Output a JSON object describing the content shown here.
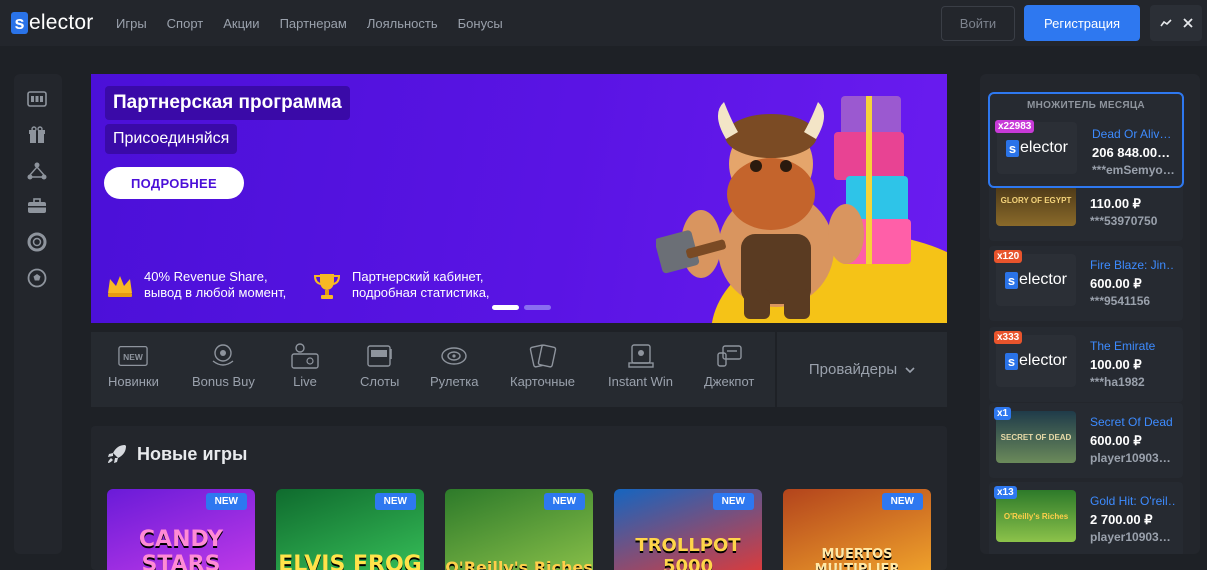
{
  "header": {
    "logo_letter": "s",
    "logo_rest": "elector",
    "nav": [
      "Игры",
      "Спорт",
      "Акции",
      "Партнерам",
      "Лояльность",
      "Бонусы"
    ],
    "login_label": "Войти",
    "register_label": "Регистрация",
    "tool_icons": [
      "chart-icon",
      "close-icon"
    ]
  },
  "sidebar": {
    "icons": [
      "slot-machine-icon",
      "gift-icon",
      "referral-icon",
      "briefcase-icon",
      "lifebuoy-icon",
      "football-icon"
    ]
  },
  "banner": {
    "title": "Партнерская программа",
    "subtitle": "Присоединяйся",
    "button": "ПОДРОБНЕЕ",
    "features": [
      {
        "line1": "40% Revenue Share,",
        "line2": "вывод в любой момент,",
        "icon": "crown-icon"
      },
      {
        "line1": "Партнерский кабинет,",
        "line2": "подробная статистика,",
        "icon": "trophy-icon"
      }
    ],
    "slides_total": 2,
    "slide_active": 1,
    "colors": {
      "bg": "#5a14e4",
      "accent": "#f5c317"
    }
  },
  "categories": [
    {
      "label": "Новинки",
      "icon": "new-icon"
    },
    {
      "label": "Bonus Buy",
      "icon": "bonus-buy-icon"
    },
    {
      "label": "Live",
      "icon": "live-icon"
    },
    {
      "label": "Слоты",
      "icon": "slots-icon"
    },
    {
      "label": "Рулетка",
      "icon": "roulette-icon"
    },
    {
      "label": "Карточные",
      "icon": "cards-icon"
    },
    {
      "label": "Instant Win",
      "icon": "instant-win-icon"
    },
    {
      "label": "Джекпот",
      "icon": "jackpot-icon"
    }
  ],
  "providers_label": "Провайдеры",
  "new_games": {
    "title": "Новые игры",
    "badge": "NEW",
    "games": [
      {
        "name": "CANDY STARS",
        "colors": [
          "#6a1bd8",
          "#c23be8"
        ]
      },
      {
        "name": "ELVIS FROG",
        "colors": [
          "#0f6b2e",
          "#38c25a"
        ]
      },
      {
        "name": "O'Reilly's Riches",
        "colors": [
          "#2d7a2a",
          "#8cc24a"
        ]
      },
      {
        "name": "TROLLPOT 5000",
        "colors": [
          "#1565c0",
          "#e53935"
        ]
      },
      {
        "name": "MUERTOS MULTIPLIER",
        "colors": [
          "#b3441c",
          "#f2a62c"
        ]
      }
    ]
  },
  "wins_panel": {
    "featured_heading": "МНОЖИТЕЛЬ МЕСЯЦА",
    "featured": {
      "multiplier": "x22983",
      "game": "Dead Or Aliv…",
      "amount": "206 848.00…",
      "user": "***emSemyo…",
      "thumb": "selector"
    },
    "rows": [
      {
        "multiplier": "",
        "game": "",
        "amount": "110.00 ₽",
        "user": "***53970750",
        "thumb": "glory-of-egypt"
      },
      {
        "multiplier": "x120",
        "game": "Fire Blaze: Jin…",
        "amount": "600.00 ₽",
        "user": "***9541156",
        "thumb": "selector",
        "mult_color": "#e8542c"
      },
      {
        "multiplier": "x333",
        "game": "The Emirate",
        "amount": "100.00 ₽",
        "user": "***ha1982",
        "thumb": "selector",
        "mult_color": "#e8542c"
      },
      {
        "multiplier": "x1",
        "game": "Secret Of Dead",
        "amount": "600.00 ₽",
        "user": "player10903…",
        "thumb": "secret-of-dead",
        "mult_color": "#2e78f0"
      },
      {
        "multiplier": "x13",
        "game": "Gold Hit: O'reil…",
        "amount": "2 700.00 ₽",
        "user": "player10903…",
        "thumb": "oreillys-riches",
        "mult_color": "#2e78f0"
      }
    ]
  }
}
